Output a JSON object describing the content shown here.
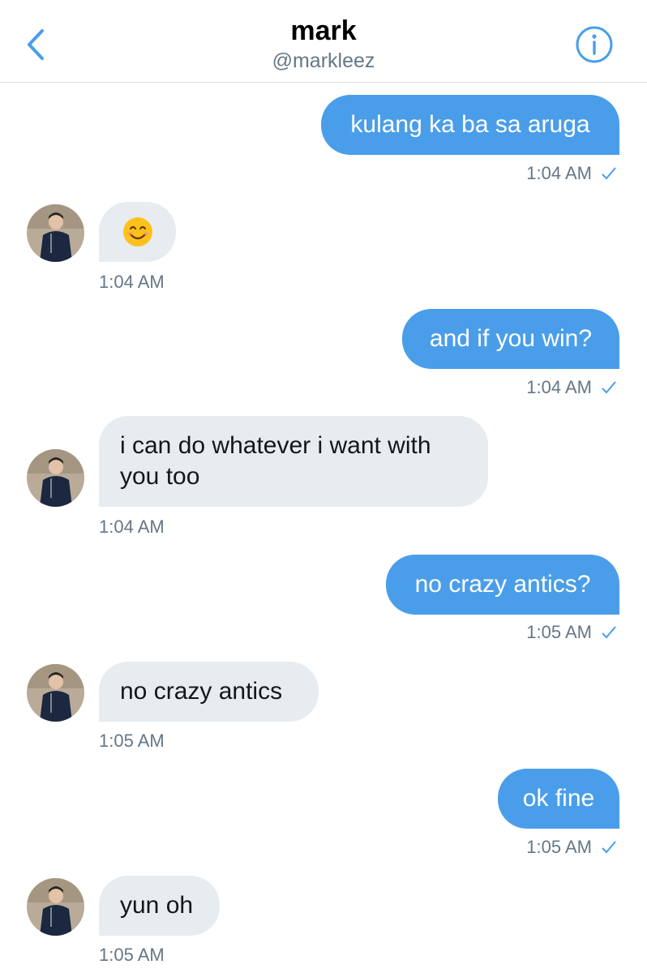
{
  "header": {
    "name": "mark",
    "handle": "@markleez"
  },
  "colors": {
    "accent": "#4a9ee9",
    "incoming_bubble": "#e6ecf0",
    "timestamp": "#657786"
  },
  "icons": {
    "back": "chevron-left-icon",
    "info": "info-circle-icon",
    "sent": "checkmark-icon",
    "emoji": "smiling-face-emoji"
  },
  "messages": [
    {
      "direction": "outgoing",
      "text": "kulang ka ba sa aruga",
      "time": "1:04 AM"
    },
    {
      "direction": "incoming",
      "text": "😊",
      "time": "1:04 AM"
    },
    {
      "direction": "outgoing",
      "text": "and if you win?",
      "time": "1:04 AM"
    },
    {
      "direction": "incoming",
      "text": "i can do whatever i want with you too",
      "time": "1:04 AM"
    },
    {
      "direction": "outgoing",
      "text": "no crazy antics?",
      "time": "1:05 AM"
    },
    {
      "direction": "incoming",
      "text": "no crazy antics",
      "time": "1:05 AM"
    },
    {
      "direction": "outgoing",
      "text": "ok fine",
      "time": "1:05 AM"
    },
    {
      "direction": "incoming",
      "text": "yun oh",
      "time": "1:05 AM"
    }
  ]
}
